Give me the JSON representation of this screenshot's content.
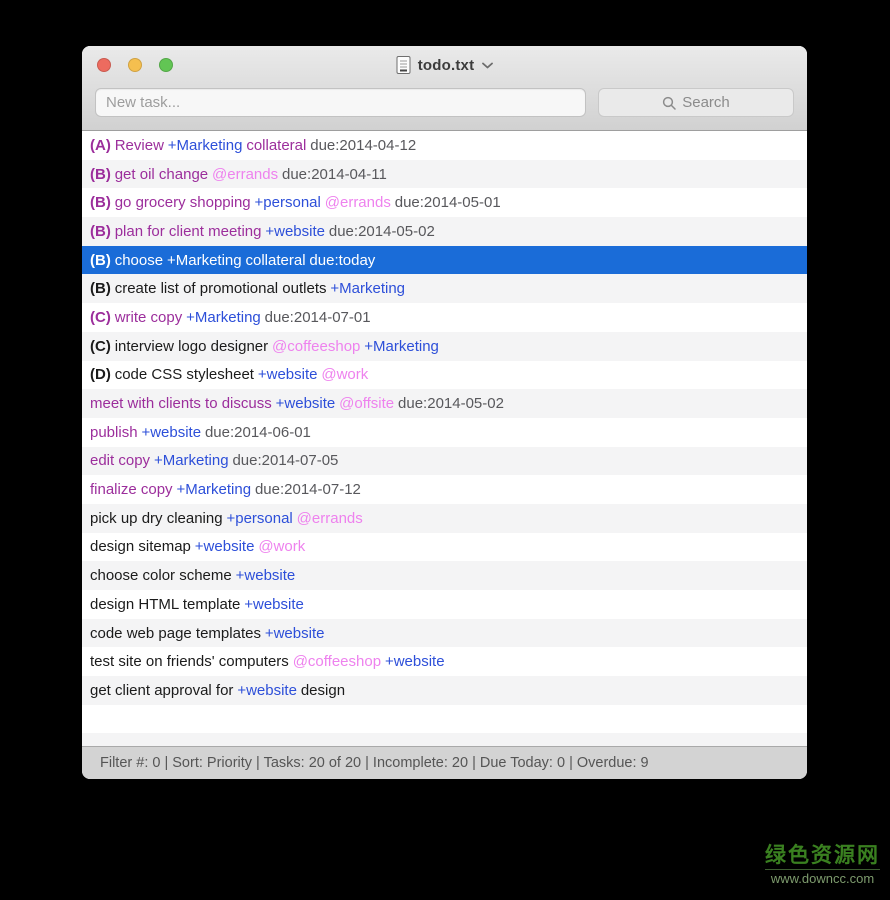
{
  "window": {
    "title": "todo.txt",
    "traffic_lights": {
      "close": "#ed6b5f",
      "minimize": "#f5bf4f",
      "zoom": "#62c554"
    }
  },
  "toolbar": {
    "new_task_placeholder": "New task...",
    "search_placeholder": "Search"
  },
  "colors": {
    "selection": "#1a6cd8",
    "overdue": "#9c2e9c",
    "project": "#2d4fd9",
    "context": "#ee82ee",
    "due": "#58585c"
  },
  "tasks": [
    {
      "state": "overdue",
      "segments": [
        {
          "t": "(A)",
          "k": "priority"
        },
        {
          "t": "Review",
          "k": "text"
        },
        {
          "t": "+Marketing",
          "k": "project"
        },
        {
          "t": "collateral",
          "k": "text"
        },
        {
          "t": "due:2014-04-12",
          "k": "due"
        }
      ]
    },
    {
      "state": "overdue",
      "segments": [
        {
          "t": "(B)",
          "k": "priority"
        },
        {
          "t": "get oil change",
          "k": "text"
        },
        {
          "t": "@errands",
          "k": "context"
        },
        {
          "t": "due:2014-04-11",
          "k": "due"
        }
      ]
    },
    {
      "state": "overdue",
      "segments": [
        {
          "t": "(B)",
          "k": "priority"
        },
        {
          "t": "go grocery shopping",
          "k": "text"
        },
        {
          "t": "+personal",
          "k": "project"
        },
        {
          "t": "@errands",
          "k": "context"
        },
        {
          "t": "due:2014-05-01",
          "k": "due"
        }
      ]
    },
    {
      "state": "overdue",
      "segments": [
        {
          "t": "(B)",
          "k": "priority"
        },
        {
          "t": "plan for client meeting",
          "k": "text"
        },
        {
          "t": "+website",
          "k": "project"
        },
        {
          "t": "due:2014-05-02",
          "k": "due"
        }
      ]
    },
    {
      "state": "selected",
      "segments": [
        {
          "t": "(B)",
          "k": "priority"
        },
        {
          "t": "choose",
          "k": "text"
        },
        {
          "t": "+Marketing",
          "k": "project"
        },
        {
          "t": "collateral",
          "k": "text"
        },
        {
          "t": "due:today",
          "k": "due"
        }
      ]
    },
    {
      "state": "normal",
      "segments": [
        {
          "t": "(B)",
          "k": "priority"
        },
        {
          "t": "create list of promotional outlets",
          "k": "text"
        },
        {
          "t": "+Marketing",
          "k": "project"
        }
      ]
    },
    {
      "state": "overdue",
      "segments": [
        {
          "t": "(C)",
          "k": "priority"
        },
        {
          "t": "write copy",
          "k": "text"
        },
        {
          "t": "+Marketing",
          "k": "project"
        },
        {
          "t": "due:2014-07-01",
          "k": "due"
        }
      ]
    },
    {
      "state": "normal",
      "segments": [
        {
          "t": "(C)",
          "k": "priority"
        },
        {
          "t": "interview logo designer",
          "k": "text"
        },
        {
          "t": "@coffeeshop",
          "k": "context"
        },
        {
          "t": "+Marketing",
          "k": "project"
        }
      ]
    },
    {
      "state": "normal",
      "segments": [
        {
          "t": "(D)",
          "k": "priority"
        },
        {
          "t": "code CSS stylesheet",
          "k": "text"
        },
        {
          "t": "+website",
          "k": "project"
        },
        {
          "t": "@work",
          "k": "context"
        }
      ]
    },
    {
      "state": "overdue",
      "segments": [
        {
          "t": "meet with clients to discuss",
          "k": "text"
        },
        {
          "t": "+website",
          "k": "project"
        },
        {
          "t": "@offsite",
          "k": "context"
        },
        {
          "t": "due:2014-05-02",
          "k": "due"
        }
      ]
    },
    {
      "state": "overdue",
      "segments": [
        {
          "t": "publish",
          "k": "text"
        },
        {
          "t": "+website",
          "k": "project"
        },
        {
          "t": "due:2014-06-01",
          "k": "due"
        }
      ]
    },
    {
      "state": "overdue",
      "segments": [
        {
          "t": "edit copy",
          "k": "text"
        },
        {
          "t": "+Marketing",
          "k": "project"
        },
        {
          "t": "due:2014-07-05",
          "k": "due"
        }
      ]
    },
    {
      "state": "overdue",
      "segments": [
        {
          "t": "finalize copy",
          "k": "text"
        },
        {
          "t": "+Marketing",
          "k": "project"
        },
        {
          "t": "due:2014-07-12",
          "k": "due"
        }
      ]
    },
    {
      "state": "normal",
      "segments": [
        {
          "t": "pick up dry cleaning",
          "k": "text"
        },
        {
          "t": "+personal",
          "k": "project"
        },
        {
          "t": "@errands",
          "k": "context"
        }
      ]
    },
    {
      "state": "normal",
      "segments": [
        {
          "t": "design sitemap",
          "k": "text"
        },
        {
          "t": "+website",
          "k": "project"
        },
        {
          "t": "@work",
          "k": "context"
        }
      ]
    },
    {
      "state": "normal",
      "segments": [
        {
          "t": "choose color scheme",
          "k": "text"
        },
        {
          "t": "+website",
          "k": "project"
        }
      ]
    },
    {
      "state": "normal",
      "segments": [
        {
          "t": "design HTML template",
          "k": "text"
        },
        {
          "t": "+website",
          "k": "project"
        }
      ]
    },
    {
      "state": "normal",
      "segments": [
        {
          "t": "code web page templates",
          "k": "text"
        },
        {
          "t": "+website",
          "k": "project"
        }
      ]
    },
    {
      "state": "normal",
      "segments": [
        {
          "t": "test site on friends' computers",
          "k": "text"
        },
        {
          "t": "@coffeeshop",
          "k": "context"
        },
        {
          "t": "+website",
          "k": "project"
        }
      ]
    },
    {
      "state": "normal",
      "segments": [
        {
          "t": "get client approval for",
          "k": "text"
        },
        {
          "t": "+website",
          "k": "project"
        },
        {
          "t": "design",
          "k": "text"
        }
      ]
    }
  ],
  "status_bar": {
    "text": "Filter #: 0 | Sort: Priority | Tasks: 20 of 20 | Incomplete: 20 | Due Today: 0 | Overdue: 9"
  },
  "watermark": {
    "site_name": "绿色资源网",
    "site_url": "www.downcc.com"
  }
}
